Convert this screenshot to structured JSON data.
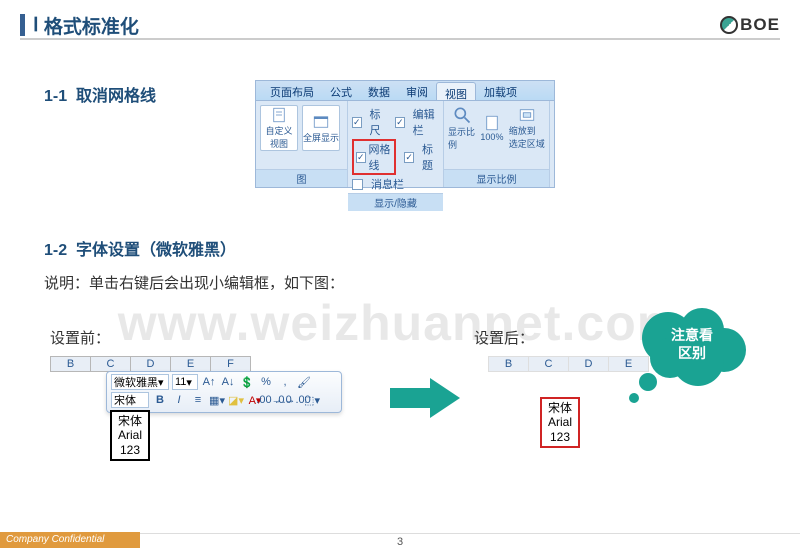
{
  "header": {
    "roman": "Ⅰ",
    "title": "格式标准化",
    "logo_text": "BOE"
  },
  "section1": {
    "number": "1-1",
    "title": "取消网格线"
  },
  "ribbon": {
    "tabs": [
      "页面布局",
      "公式",
      "数据",
      "审阅",
      "视图",
      "加载项"
    ],
    "active_tab_index": 4,
    "group_left_label": "图",
    "btn_custom": "自定义\n视图",
    "btn_fullscreen": "全屏显示",
    "group_mid_label": "显示/隐藏",
    "chk_ruler": "标尺",
    "chk_gridlines": "网格线",
    "chk_msgbar": "消息栏",
    "chk_formula": "编辑栏",
    "chk_headings": "标题",
    "group_right_label": "显示比例",
    "btn_zoom": "显示比例",
    "btn_100": "100%",
    "btn_zoomsel": "缩放到\n选定区域"
  },
  "section2": {
    "number": "1-2",
    "title": "字体设置（微软雅黑）",
    "desc": "说明：单击右键后会出现小编辑框，如下图："
  },
  "compare": {
    "before_label": "设置前：",
    "after_label": "设置后：",
    "columns": [
      "B",
      "C",
      "D",
      "E",
      "F"
    ],
    "sample_lines": [
      "宋体",
      "Arial",
      "123"
    ]
  },
  "mini_toolbar": {
    "font": "微软雅黑",
    "size": "11",
    "font2": "宋体"
  },
  "cloud": {
    "line1": "注意看",
    "line2": "区别"
  },
  "watermark": "www.weizhuannet.com",
  "footer": "Company Confidential",
  "page": "3"
}
